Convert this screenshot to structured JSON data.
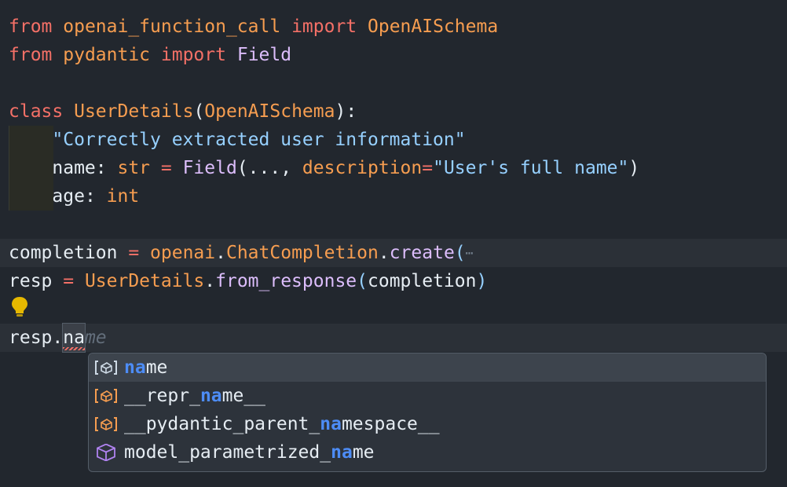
{
  "code": {
    "l1": {
      "kw1": "from",
      "mod": "openai_function_call",
      "kw2": "import",
      "name": "OpenAISchema"
    },
    "l2": {
      "kw1": "from",
      "mod": "pydantic",
      "kw2": "import",
      "name": "Field"
    },
    "l3": {
      "kw": "class",
      "name": "UserDetails",
      "open": "(",
      "base": "OpenAISchema",
      "close": "):"
    },
    "l4": {
      "doc": "\"Correctly extracted user information\""
    },
    "l5": {
      "var": "name",
      "colon": ": ",
      "type": "str",
      "eq": " = ",
      "call": "Field",
      "args1": "(..., ",
      "param": "description",
      "eq2": "=",
      "str": "\"User's full name\"",
      "close": ")"
    },
    "l6": {
      "var": "age",
      "colon": ": ",
      "type": "int"
    },
    "l7": {
      "var": "completion",
      "eq": " = ",
      "mod": "openai",
      "dot": ".",
      "cls": "ChatCompletion",
      "dot2": ".",
      "meth": "create",
      "paren": "(",
      "fold": "⋯"
    },
    "l8": {
      "var": "resp",
      "eq": " = ",
      "cls": "UserDetails",
      "dot": ".",
      "meth": "from_response",
      "open": "(",
      "arg": "completion",
      "close": ")"
    },
    "l9": {
      "obj": "resp.",
      "typed": "na",
      "ghost": "me"
    }
  },
  "suggestions": [
    {
      "pre": "",
      "match": "na",
      "post": "me",
      "icon": "field-icon",
      "selected": true
    },
    {
      "pre": "__repr_",
      "match": "na",
      "post": "me__",
      "icon": "field-icon",
      "selected": false
    },
    {
      "pre": "__pydantic_parent_",
      "match": "na",
      "post": "mespace__",
      "icon": "field-icon",
      "selected": false
    },
    {
      "pre": "model_parametrized_",
      "match": "na",
      "post": "me",
      "icon": "cube-icon",
      "selected": false
    }
  ],
  "colors": {
    "background": "#22272e",
    "keyword": "#f47067",
    "class": "#f69d50",
    "string": "#96d0ff",
    "function": "#dcbdfb",
    "match": "#4d8cf5",
    "bulb": "#e6b800"
  }
}
